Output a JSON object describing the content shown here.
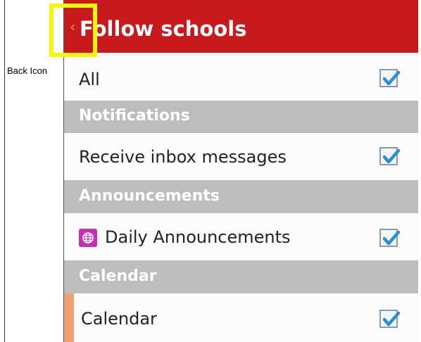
{
  "annotation": {
    "label": "Back Icon"
  },
  "header": {
    "title": "Follow schools",
    "back_glyph": "‹",
    "back_icon": "chevron-left-icon"
  },
  "rows": {
    "all": {
      "label": "All",
      "checked": true
    },
    "notifications_header": "Notifications",
    "inbox": {
      "label": "Receive inbox messages",
      "checked": true
    },
    "announcements_header": "Announcements",
    "daily": {
      "label": "Daily Announcements",
      "checked": true,
      "icon": "globe-icon"
    },
    "calendar_header": "Calendar",
    "calendar": {
      "label": "Calendar",
      "checked": true
    }
  },
  "colors": {
    "header_bg": "#c8191c",
    "section_bg": "#bdbdbd",
    "highlight": "#f5f510",
    "check": "#2a8fd0",
    "calendar_accent": "#f0a06e",
    "app_icon_bg": "#c62fb3"
  }
}
